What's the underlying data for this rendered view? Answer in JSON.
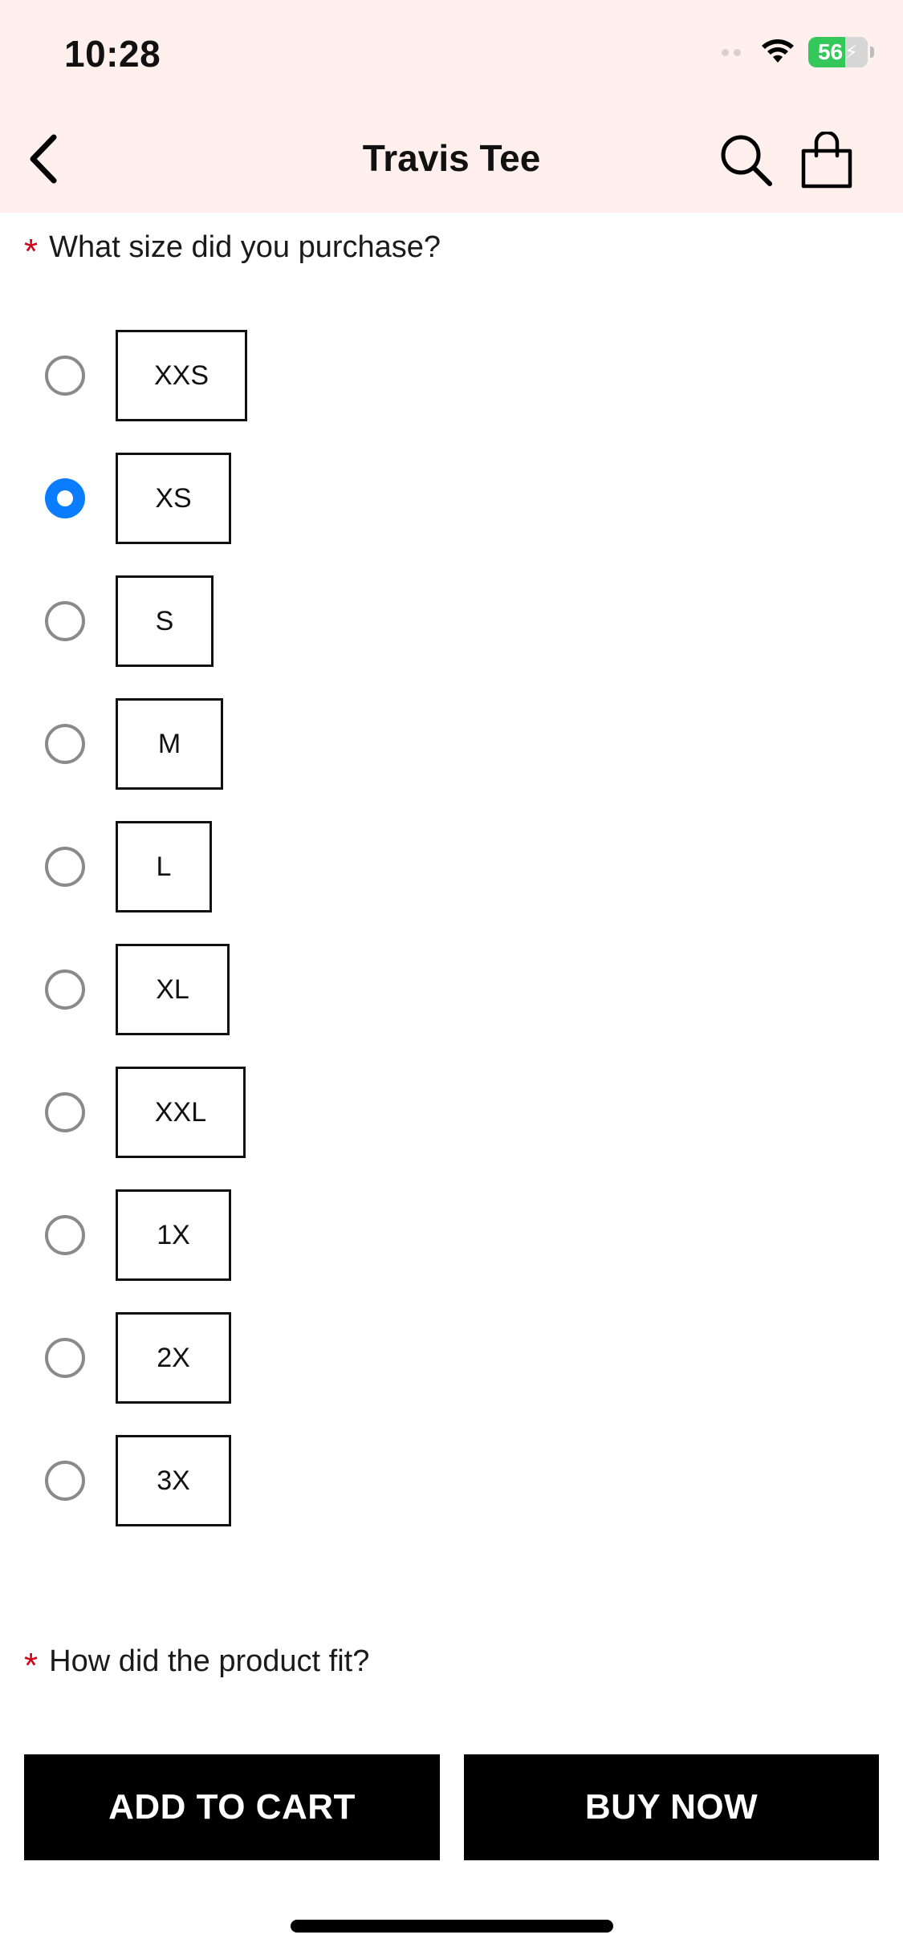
{
  "status_bar": {
    "time": "10:28",
    "battery_percent": "56",
    "battery_color": "#34c759"
  },
  "header": {
    "title": "Travis Tee",
    "icons": {
      "back": "chevron-left-icon",
      "search": "search-icon",
      "bag": "shopping-bag-icon"
    }
  },
  "questions": {
    "size": {
      "required_mark": "*",
      "label": "What size did you purchase?"
    },
    "fit": {
      "required_mark": "*",
      "label": "How did the product fit?"
    }
  },
  "sizes": {
    "selected": "XS",
    "options": [
      {
        "label": "XXS"
      },
      {
        "label": "XS"
      },
      {
        "label": "S"
      },
      {
        "label": "M"
      },
      {
        "label": "L"
      },
      {
        "label": "XL"
      },
      {
        "label": "XXL"
      },
      {
        "label": "1X"
      },
      {
        "label": "2X"
      },
      {
        "label": "3X"
      }
    ]
  },
  "actions": {
    "add_to_cart": "ADD TO CART",
    "buy_now": "BUY NOW"
  },
  "colors": {
    "header_bg": "#fff0ee",
    "radio_selected": "#0a7cff",
    "required": "#d0021b",
    "button_bg": "#000000"
  }
}
